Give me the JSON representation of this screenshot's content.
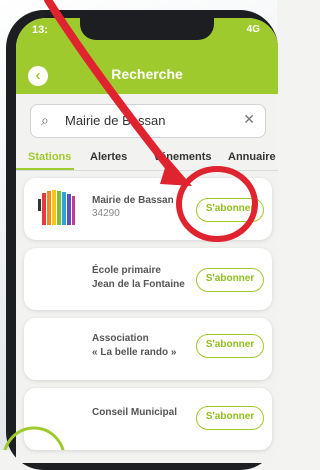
{
  "status": {
    "time": "13:",
    "right": "4G"
  },
  "header": {
    "title": "Recherche",
    "back_icon": "chevron-left-icon"
  },
  "search": {
    "value": "Mairie de Bassan",
    "icon": "search-icon",
    "clear_icon": "close-icon"
  },
  "tabs": [
    {
      "label": "Stations",
      "active": true
    },
    {
      "label": "Alertes",
      "active": false
    },
    {
      "label": "vénements",
      "active": false
    },
    {
      "label": "Annuaire",
      "active": false
    }
  ],
  "results": [
    {
      "name": "Mairie de Bassan",
      "sub": "34290",
      "button": "S'abonner"
    },
    {
      "name_line1": "École primaire",
      "name_line2": "Jean de la Fontaine",
      "button": "S'abonner"
    },
    {
      "name_line1": "Association",
      "name_line2": "« La belle rando »",
      "button": "S'abonner"
    },
    {
      "name": "Conseil Municipal",
      "button": "S'abonner"
    }
  ],
  "colors": {
    "accent": "#9fca2e",
    "annotation": "#e0242f"
  }
}
